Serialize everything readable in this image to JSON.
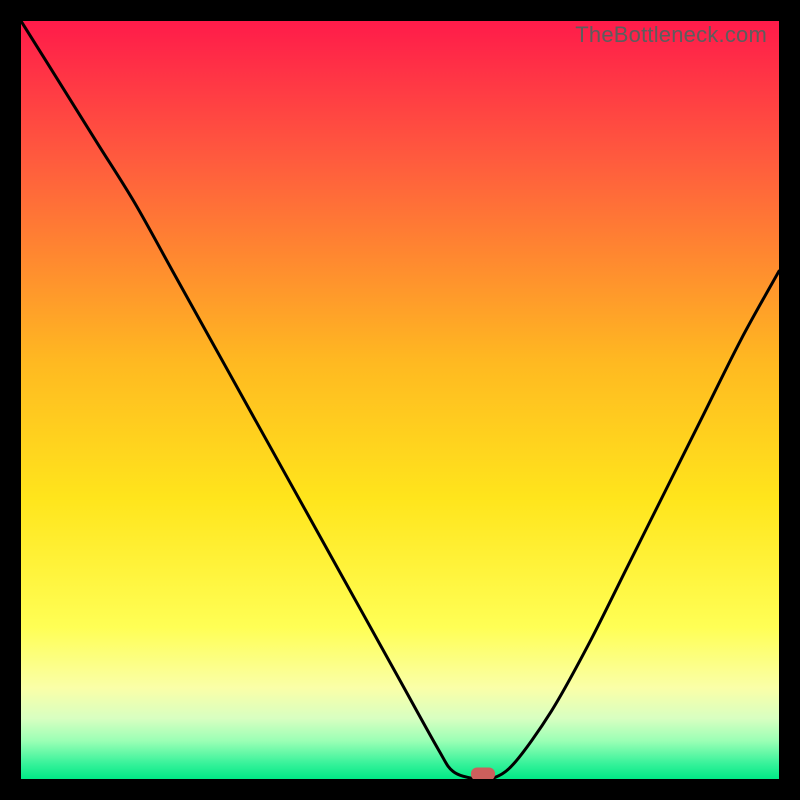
{
  "watermark": "TheBottleneck.com",
  "colors": {
    "top": "#ff1b4a",
    "upper": "#ff6a3a",
    "mid": "#ffd21f",
    "lower_yellow": "#ffff66",
    "pale": "#f4ffc7",
    "green_light": "#8dffb0",
    "green": "#00e986",
    "curve": "#000000",
    "marker": "#cb5f5c",
    "frame": "#000000"
  },
  "chart_data": {
    "type": "line",
    "title": "",
    "xlabel": "",
    "ylabel": "",
    "xlim": [
      0,
      100
    ],
    "ylim": [
      0,
      100
    ],
    "grid": false,
    "legend": false,
    "series": [
      {
        "name": "bottleneck-curve",
        "x": [
          0,
          5,
          10,
          15,
          20,
          25,
          30,
          35,
          40,
          45,
          50,
          55,
          57,
          60,
          62,
          65,
          70,
          75,
          80,
          85,
          90,
          95,
          100
        ],
        "y": [
          100,
          92,
          84,
          76,
          67,
          58,
          49,
          40,
          31,
          22,
          13,
          4,
          1,
          0,
          0,
          2,
          9,
          18,
          28,
          38,
          48,
          58,
          67
        ]
      }
    ],
    "marker": {
      "x": 61,
      "y": 0
    },
    "gradient_stops": [
      {
        "pct": 0,
        "color": "#ff1b4a"
      },
      {
        "pct": 18,
        "color": "#ff5a3e"
      },
      {
        "pct": 45,
        "color": "#ffb921"
      },
      {
        "pct": 63,
        "color": "#ffe51c"
      },
      {
        "pct": 80,
        "color": "#ffff55"
      },
      {
        "pct": 88,
        "color": "#faffa8"
      },
      {
        "pct": 92,
        "color": "#d8ffc1"
      },
      {
        "pct": 95,
        "color": "#9affb5"
      },
      {
        "pct": 98,
        "color": "#36f29a"
      },
      {
        "pct": 100,
        "color": "#00e986"
      }
    ]
  }
}
